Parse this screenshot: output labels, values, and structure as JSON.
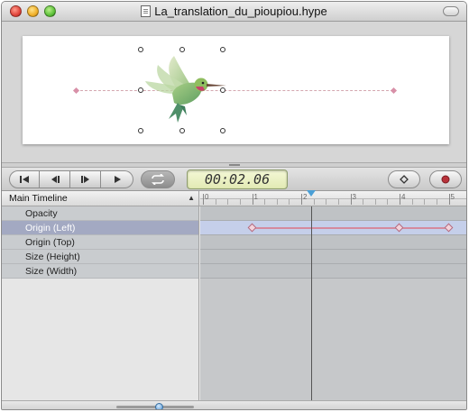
{
  "window": {
    "title": "La_translation_du_pioupiou.hype"
  },
  "icons": {
    "close": "close-icon",
    "minimize": "minimize-icon",
    "zoom": "zoom-icon",
    "document": "document-icon",
    "toolbar_toggle": "toolbar-toggle-icon",
    "go_to_start": "skip-to-start-icon",
    "step_back": "step-back-icon",
    "step_forward": "step-forward-icon",
    "play": "play-icon",
    "loop": "loop-icon",
    "add_keyframe": "diamond-icon",
    "record": "record-icon",
    "hummingbird": "hummingbird-icon",
    "dropdown": "chevron-up-down-icon"
  },
  "colors": {
    "selected_row": "#a3a9c2",
    "keyframe": "#d48a9e",
    "playhead": "#4a9fd6",
    "timecode_bg": "#e2eab4"
  },
  "playback": {
    "timecode": "00:02.06",
    "playhead_seconds": 2.2
  },
  "timeline": {
    "selector_label": "Main Timeline",
    "ruler": {
      "labels": [
        "0",
        "1",
        "2",
        "3",
        "4",
        "5"
      ]
    },
    "properties": [
      {
        "label": "Opacity",
        "selected": false
      },
      {
        "label": "Origin (Left)",
        "selected": true
      },
      {
        "label": "Origin (Top)",
        "selected": false
      },
      {
        "label": "Size (Height)",
        "selected": false
      },
      {
        "label": "Size (Width)",
        "selected": false
      }
    ],
    "keyframes_origin_left_seconds": [
      1,
      4,
      5
    ]
  },
  "zoom_slider": {
    "value": 0.55
  }
}
